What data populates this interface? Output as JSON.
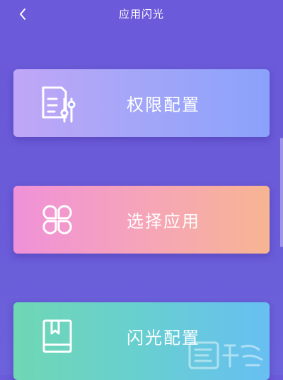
{
  "header": {
    "back_icon": "chevron-left-icon",
    "title": "应用闪光"
  },
  "cards": [
    {
      "label": "权限配置",
      "icon": "document-settings-icon"
    },
    {
      "label": "选择应用",
      "icon": "four-petal-apps-icon"
    },
    {
      "label": "闪光配置",
      "icon": "bookmark-book-icon"
    }
  ],
  "colors": {
    "background": "#6b5ad9",
    "card_permissions": [
      "#c1a6f6",
      "#8aa2fb"
    ],
    "card_select_app": [
      "#f091d9",
      "#f7b592"
    ],
    "card_flash": [
      "#6fd7b4",
      "#67bff2"
    ]
  }
}
